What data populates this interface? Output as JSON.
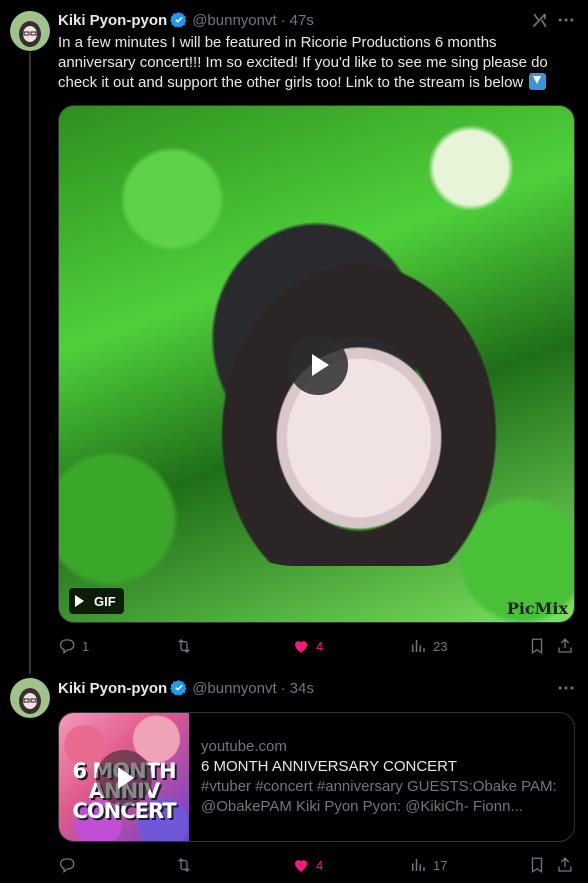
{
  "colors": {
    "background": "#000000",
    "text": "#e7e9ea",
    "muted": "#71767b",
    "like": "#f91880",
    "verified": "#1d9bf0",
    "border": "#2f3336"
  },
  "tweets": [
    {
      "author": {
        "name": "Kiki Pyon-pyon",
        "handle": "@bunnyonvt",
        "verified": true
      },
      "time": "47s",
      "text": "In a few minutes I will be featured in Ricorie Productions 6 months anniversary concert!!! Im so excited! If you'd like to see me sing please do check it out and support the other girls too! Link to the stream is below",
      "emoji": "down-arrow-emoji",
      "media": {
        "badge": "GIF",
        "watermark": "PicMix"
      },
      "metrics": {
        "replies": "1",
        "retweets": "",
        "likes": "4",
        "views": "23"
      }
    },
    {
      "author": {
        "name": "Kiki Pyon-pyon",
        "handle": "@bunnyonvt",
        "verified": true
      },
      "time": "34s",
      "card": {
        "thumb_text": "6 MONTH ANNIV CONCERT",
        "domain": "youtube.com",
        "title": "6 MONTH ANNIVERSARY CONCERT",
        "description": "#vtuber #concert #anniversary GUESTS:Obake PAM: @ObakePAM Kiki Pyon Pyon: @KikiCh- Fionn..."
      },
      "metrics": {
        "replies": "",
        "retweets": "",
        "likes": "4",
        "views": "17"
      }
    }
  ]
}
